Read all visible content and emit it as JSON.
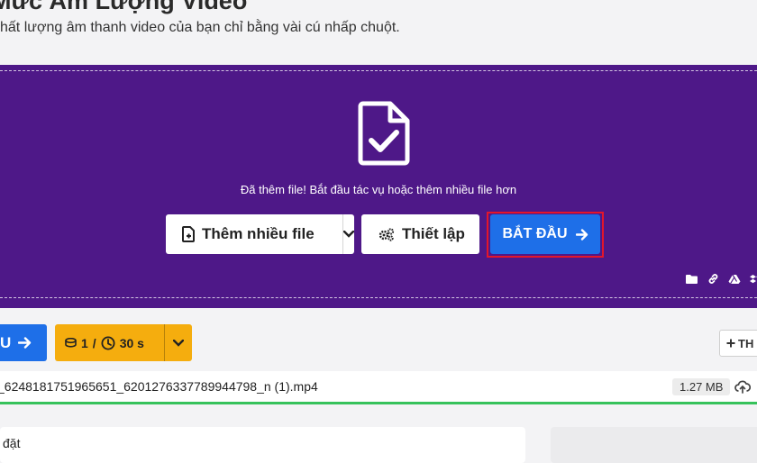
{
  "header": {
    "title": "Mức Âm Lượng Video",
    "subtitle": "hất lượng âm thanh video của bạn chỉ bằng vài cú nhấp chuột."
  },
  "dropzone": {
    "status_message": "Đã thêm file! Bắt đầu tác vụ hoặc thêm nhiều file hơn",
    "add_files_label": "Thêm nhiều file",
    "settings_label": "Thiết lập",
    "start_label": "BẮT ĐẦU",
    "source_icons": [
      "folder-icon",
      "link-icon",
      "google-drive-icon",
      "dropbox-icon"
    ]
  },
  "toolbar": {
    "start_label": "U",
    "credits_count": "1",
    "credits_separator": "/",
    "time_value": "30 s",
    "add_more_label": "TH"
  },
  "file": {
    "name": "_6248181751965651_6201276337789944798_n (1).mp4",
    "size": "1.27 MB",
    "progress": 1.0
  },
  "settings_panel": {
    "label": "ị đặt"
  },
  "colors": {
    "panel": "#4e1888",
    "primary": "#1e6fe8",
    "credits": "#f5ad0e",
    "highlight": "#e3162b",
    "progress": "#36c25b"
  }
}
